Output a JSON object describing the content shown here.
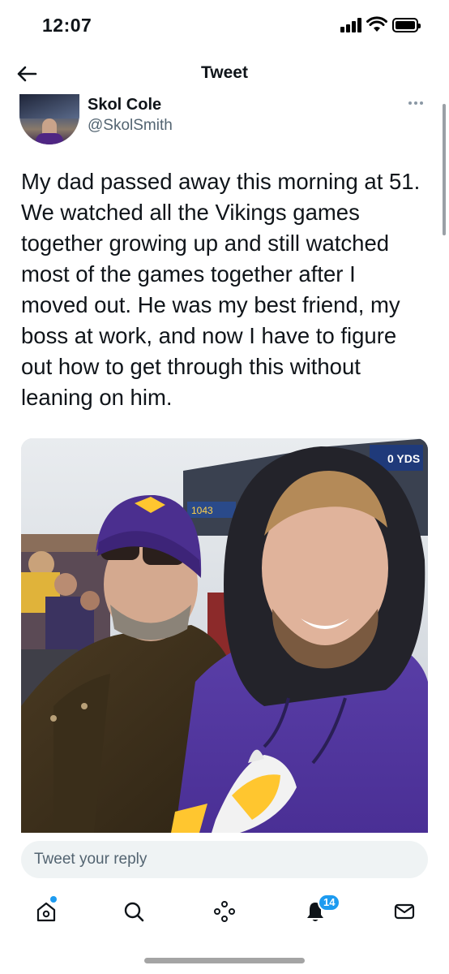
{
  "status_bar": {
    "time": "12:07",
    "icons": [
      "signal-icon",
      "wifi-icon",
      "battery-icon"
    ]
  },
  "header": {
    "title": "Tweet",
    "back_icon": "arrow-left-icon"
  },
  "author": {
    "display_name": "Skol Cole",
    "handle": "@SkolSmith",
    "more_icon": "more-horizontal-icon"
  },
  "tweet": {
    "text": "My dad passed away this morning at 51. We watched all the Vikings games together growing up and still watched most of the games together after I moved out. He was my best friend, my boss at work, and now I have to figure out how to get through this without leaning on him."
  },
  "photo": {
    "scoreboard_text": "0 YDS",
    "stand_number": "1043"
  },
  "reply": {
    "placeholder": "Tweet your reply"
  },
  "tab_bar": {
    "items": [
      {
        "name": "home",
        "icon": "home-icon"
      },
      {
        "name": "search",
        "icon": "search-icon"
      },
      {
        "name": "spaces",
        "icon": "spaces-icon"
      },
      {
        "name": "notifications",
        "icon": "bell-icon",
        "badge": "14"
      },
      {
        "name": "messages",
        "icon": "mail-icon"
      }
    ]
  },
  "colors": {
    "accent": "#1d9bf0",
    "text": "#0f1419",
    "secondary": "#536471",
    "vikings_purple": "#4f2683",
    "vikings_gold": "#ffc62f"
  }
}
